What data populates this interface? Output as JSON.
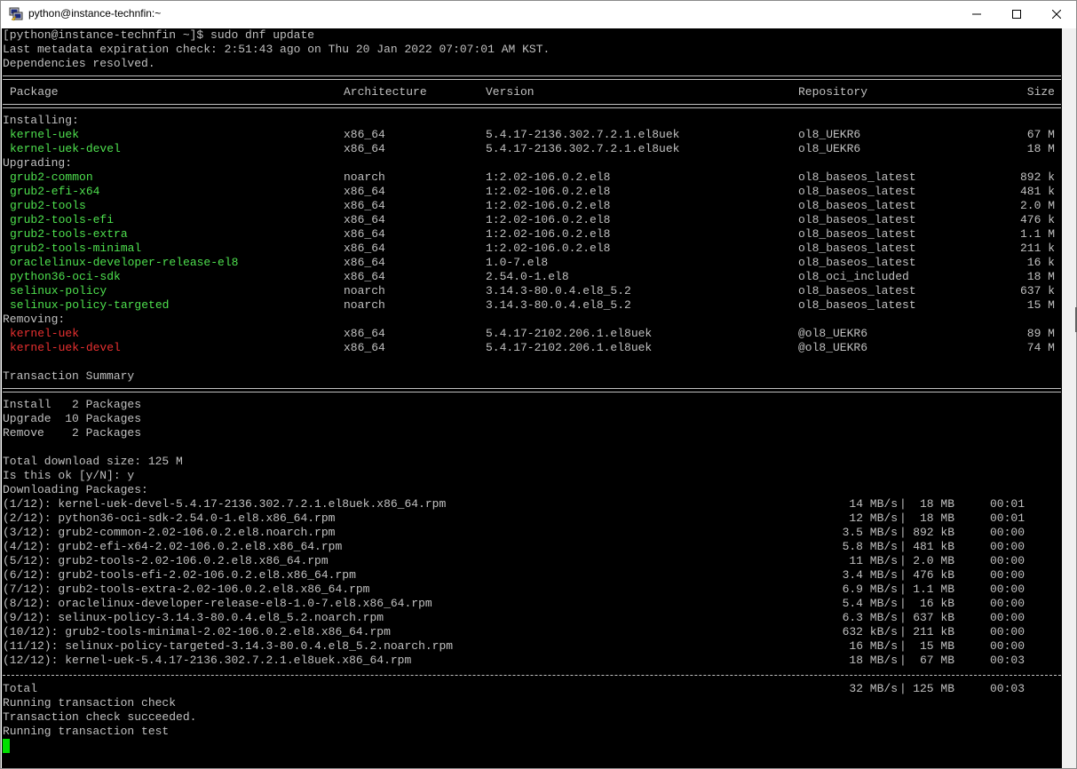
{
  "window": {
    "title": "python@instance-technfin:~"
  },
  "terminal": {
    "header_lines": [
      "[python@instance-technfin ~]$ sudo dnf update",
      "Last metadata expiration check: 2:51:43 ago on Thu 20 Jan 2022 07:07:01 AM KST.",
      "Dependencies resolved."
    ],
    "table_header": {
      "package": "Package",
      "arch": "Architecture",
      "version": "Version",
      "repo": "Repository",
      "size": "Size"
    },
    "sections": [
      {
        "label": "Installing:",
        "color": "#4ee04e",
        "rows": [
          {
            "name": "kernel-uek",
            "arch": "x86_64",
            "version": "5.4.17-2136.302.7.2.1.el8uek",
            "repo": "ol8_UEKR6",
            "size": "67 M"
          },
          {
            "name": "kernel-uek-devel",
            "arch": "x86_64",
            "version": "5.4.17-2136.302.7.2.1.el8uek",
            "repo": "ol8_UEKR6",
            "size": "18 M"
          }
        ]
      },
      {
        "label": "Upgrading:",
        "color": "#4ee04e",
        "rows": [
          {
            "name": "grub2-common",
            "arch": "noarch",
            "version": "1:2.02-106.0.2.el8",
            "repo": "ol8_baseos_latest",
            "size": "892 k"
          },
          {
            "name": "grub2-efi-x64",
            "arch": "x86_64",
            "version": "1:2.02-106.0.2.el8",
            "repo": "ol8_baseos_latest",
            "size": "481 k"
          },
          {
            "name": "grub2-tools",
            "arch": "x86_64",
            "version": "1:2.02-106.0.2.el8",
            "repo": "ol8_baseos_latest",
            "size": "2.0 M"
          },
          {
            "name": "grub2-tools-efi",
            "arch": "x86_64",
            "version": "1:2.02-106.0.2.el8",
            "repo": "ol8_baseos_latest",
            "size": "476 k"
          },
          {
            "name": "grub2-tools-extra",
            "arch": "x86_64",
            "version": "1:2.02-106.0.2.el8",
            "repo": "ol8_baseos_latest",
            "size": "1.1 M"
          },
          {
            "name": "grub2-tools-minimal",
            "arch": "x86_64",
            "version": "1:2.02-106.0.2.el8",
            "repo": "ol8_baseos_latest",
            "size": "211 k"
          },
          {
            "name": "oraclelinux-developer-release-el8",
            "arch": "x86_64",
            "version": "1.0-7.el8",
            "repo": "ol8_baseos_latest",
            "size": "16 k"
          },
          {
            "name": "python36-oci-sdk",
            "arch": "x86_64",
            "version": "2.54.0-1.el8",
            "repo": "ol8_oci_included",
            "size": "18 M"
          },
          {
            "name": "selinux-policy",
            "arch": "noarch",
            "version": "3.14.3-80.0.4.el8_5.2",
            "repo": "ol8_baseos_latest",
            "size": "637 k"
          },
          {
            "name": "selinux-policy-targeted",
            "arch": "noarch",
            "version": "3.14.3-80.0.4.el8_5.2",
            "repo": "ol8_baseos_latest",
            "size": "15 M"
          }
        ]
      },
      {
        "label": "Removing:",
        "color": "#e83030",
        "rows": [
          {
            "name": "kernel-uek",
            "arch": "x86_64",
            "version": "5.4.17-2102.206.1.el8uek",
            "repo": "@ol8_UEKR6",
            "size": "89 M"
          },
          {
            "name": "kernel-uek-devel",
            "arch": "x86_64",
            "version": "5.4.17-2102.206.1.el8uek",
            "repo": "@ol8_UEKR6",
            "size": "74 M"
          }
        ]
      }
    ],
    "summary_title": "Transaction Summary",
    "summary_lines": [
      "Install   2 Packages",
      "Upgrade  10 Packages",
      "Remove    2 Packages"
    ],
    "pre_download_lines": [
      "Total download size: 125 M",
      "Is this ok [y/N]: y",
      "Downloading Packages:"
    ],
    "downloads": [
      {
        "file": "(1/12): kernel-uek-devel-5.4.17-2136.302.7.2.1.el8uek.x86_64.rpm",
        "speed": "14 MB/s",
        "size": "18 MB",
        "time": "00:01"
      },
      {
        "file": "(2/12): python36-oci-sdk-2.54.0-1.el8.x86_64.rpm",
        "speed": "12 MB/s",
        "size": "18 MB",
        "time": "00:01"
      },
      {
        "file": "(3/12): grub2-common-2.02-106.0.2.el8.noarch.rpm",
        "speed": "3.5 MB/s",
        "size": "892 kB",
        "time": "00:00"
      },
      {
        "file": "(4/12): grub2-efi-x64-2.02-106.0.2.el8.x86_64.rpm",
        "speed": "5.8 MB/s",
        "size": "481 kB",
        "time": "00:00"
      },
      {
        "file": "(5/12): grub2-tools-2.02-106.0.2.el8.x86_64.rpm",
        "speed": "11 MB/s",
        "size": "2.0 MB",
        "time": "00:00"
      },
      {
        "file": "(6/12): grub2-tools-efi-2.02-106.0.2.el8.x86_64.rpm",
        "speed": "3.4 MB/s",
        "size": "476 kB",
        "time": "00:00"
      },
      {
        "file": "(7/12): grub2-tools-extra-2.02-106.0.2.el8.x86_64.rpm",
        "speed": "6.9 MB/s",
        "size": "1.1 MB",
        "time": "00:00"
      },
      {
        "file": "(8/12): oraclelinux-developer-release-el8-1.0-7.el8.x86_64.rpm",
        "speed": "5.4 MB/s",
        "size": "16 kB",
        "time": "00:00"
      },
      {
        "file": "(9/12): selinux-policy-3.14.3-80.0.4.el8_5.2.noarch.rpm",
        "speed": "6.3 MB/s",
        "size": "637 kB",
        "time": "00:00"
      },
      {
        "file": "(10/12): grub2-tools-minimal-2.02-106.0.2.el8.x86_64.rpm",
        "speed": "632 kB/s",
        "size": "211 kB",
        "time": "00:00"
      },
      {
        "file": "(11/12): selinux-policy-targeted-3.14.3-80.0.4.el8_5.2.noarch.rpm",
        "speed": "16 MB/s",
        "size": "15 MB",
        "time": "00:00"
      },
      {
        "file": "(12/12): kernel-uek-5.4.17-2136.302.7.2.1.el8uek.x86_64.rpm",
        "speed": "18 MB/s",
        "size": "67 MB",
        "time": "00:03"
      }
    ],
    "total": {
      "label": "Total",
      "speed": "32 MB/s",
      "size": "125 MB",
      "time": "00:03"
    },
    "final_lines": [
      "Running transaction check",
      "Transaction check succeeded.",
      "Running transaction test"
    ]
  },
  "icons": {
    "app": "putty-icon",
    "minimize": "minimize-icon",
    "maximize": "maximize-icon",
    "close": "close-icon"
  },
  "colors": {
    "terminal_bg": "#000000",
    "terminal_fg": "#c0c0c0",
    "package_green": "#4ee04e",
    "package_red": "#e83030",
    "cursor": "#00e000"
  }
}
